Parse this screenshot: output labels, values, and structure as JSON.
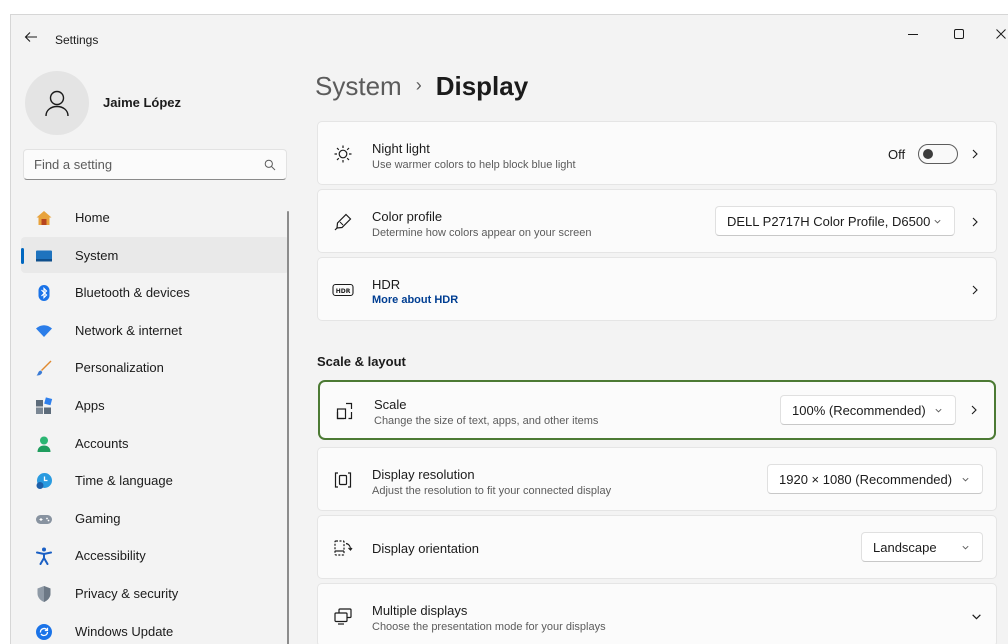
{
  "window": {
    "title": "Settings"
  },
  "profile": {
    "name": "Jaime López"
  },
  "search": {
    "placeholder": "Find a setting"
  },
  "nav": {
    "items": [
      {
        "label": "Home",
        "icon": "home-icon"
      },
      {
        "label": "System",
        "icon": "monitor-icon",
        "active": true
      },
      {
        "label": "Bluetooth & devices",
        "icon": "bluetooth-icon"
      },
      {
        "label": "Network & internet",
        "icon": "wifi-icon"
      },
      {
        "label": "Personalization",
        "icon": "brush-icon"
      },
      {
        "label": "Apps",
        "icon": "apps-icon"
      },
      {
        "label": "Accounts",
        "icon": "person-icon"
      },
      {
        "label": "Time & language",
        "icon": "clock-globe-icon"
      },
      {
        "label": "Gaming",
        "icon": "gamepad-icon"
      },
      {
        "label": "Accessibility",
        "icon": "accessibility-icon"
      },
      {
        "label": "Privacy & security",
        "icon": "shield-icon"
      },
      {
        "label": "Windows Update",
        "icon": "update-icon"
      }
    ]
  },
  "breadcrumb": {
    "parent": "System",
    "separator": "›",
    "current": "Display"
  },
  "cards": {
    "night_light": {
      "title": "Night light",
      "subtitle": "Use warmer colors to help block blue light",
      "state_label": "Off",
      "toggle_on": false
    },
    "color_profile": {
      "title": "Color profile",
      "subtitle": "Determine how colors appear on your screen",
      "value": "DELL P2717H Color Profile, D6500"
    },
    "hdr": {
      "title": "HDR",
      "link": "More about HDR",
      "icon_text": "HDR"
    },
    "scale": {
      "title": "Scale",
      "subtitle": "Change the size of text, apps, and other items",
      "value": "100% (Recommended)"
    },
    "resolution": {
      "title": "Display resolution",
      "subtitle": "Adjust the resolution to fit your connected display",
      "value": "1920 × 1080 (Recommended)"
    },
    "orientation": {
      "title": "Display orientation",
      "value": "Landscape"
    },
    "multiple": {
      "title": "Multiple displays",
      "subtitle": "Choose the presentation mode for your displays"
    }
  },
  "sections": {
    "scale_layout": "Scale & layout"
  },
  "colors": {
    "accent": "#0067c0",
    "focus_outline": "#4c7a34",
    "window_bg": "#f3f3f3",
    "card_bg": "#fbfbfb"
  }
}
